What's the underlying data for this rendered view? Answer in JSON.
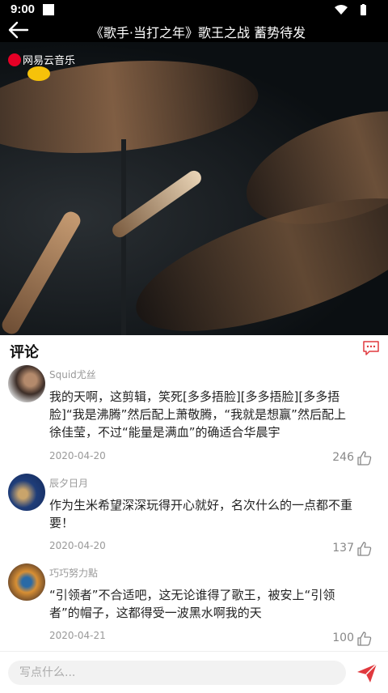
{
  "status_bar": {
    "time": "9:00"
  },
  "header": {
    "title": "《歌手·当打之年》歌王之战 蓄势待发"
  },
  "video": {
    "watermark": "网易云音乐"
  },
  "comments": {
    "title": "评论",
    "items": [
      {
        "user": "Squid尤丝",
        "text": "我的天啊，这剪辑，笑死[多多捂脸][多多捂脸][多多捂脸]“我是沸腾”然后配上萧敬腾，“我就是想赢”然后配上徐佳莹，不过“能量是满血”的确适合华晨宇",
        "date": "2020-04-20",
        "likes": "246"
      },
      {
        "user": "辰夕日月",
        "text": "作为生米希望深深玩得开心就好，名次什么的一点都不重要！",
        "date": "2020-04-20",
        "likes": "137"
      },
      {
        "user": "巧巧努力點",
        "text": "“引领者”不合适吧，这无论谁得了歌王，被安上“引领者”的帽子，这都得受一波黑水啊我的天",
        "date": "2020-04-21",
        "likes": "100"
      }
    ]
  },
  "input": {
    "placeholder": "写点什么..."
  },
  "colors": {
    "accent": "#e0393e"
  }
}
